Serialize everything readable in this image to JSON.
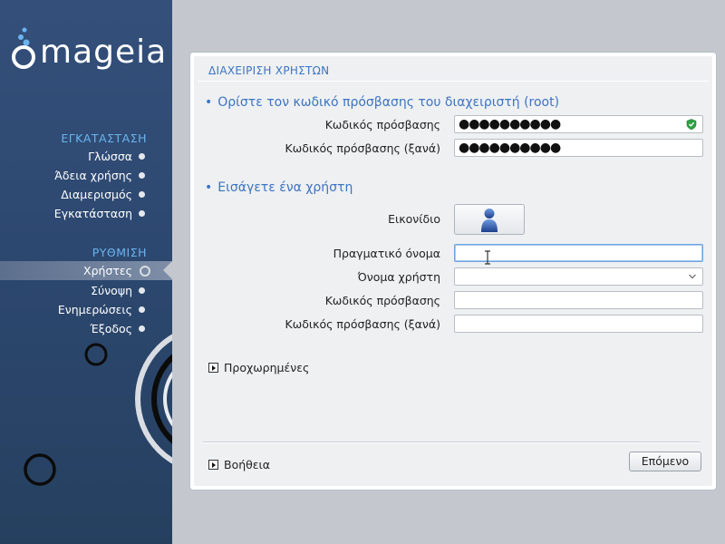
{
  "brand": {
    "logo_text": "mageia"
  },
  "sidebar": {
    "install_section": "ΕΓΚΑΤΑΣΤΑΣΗ",
    "install_items": [
      {
        "label": "Γλώσσα"
      },
      {
        "label": "Άδεια χρήσης"
      },
      {
        "label": "Διαμερισμός"
      },
      {
        "label": "Εγκατάσταση"
      }
    ],
    "config_section": "ΡΥΘΜΙΣΗ",
    "config_items": [
      {
        "label": "Χρήστες",
        "active": true
      },
      {
        "label": "Σύνοψη"
      },
      {
        "label": "Ενημερώσεις"
      },
      {
        "label": "Έξοδος"
      }
    ]
  },
  "panel": {
    "title": "ΔΙΑΧΕΙΡΙΣΗ ΧΡΗΣΤΩΝ",
    "root_section": {
      "bullet": "•",
      "heading": "Ορίστε τον κωδικό πρόσβασης του διαχειριστή (root)",
      "password_label": "Κωδικός πρόσβασης",
      "password_value": "●●●●●●●●●●",
      "password_again_label": "Κωδικός πρόσβασης (ξανά)",
      "password_again_value": "●●●●●●●●●●"
    },
    "user_section": {
      "bullet": "•",
      "heading": "Εισάγετε ένα χρήστη",
      "icon_label": "Εικονίδιο",
      "real_name_label": "Πραγματικό όνομα",
      "real_name_value": "",
      "username_label": "Όνομα χρήστη",
      "username_value": "",
      "password_label": "Κωδικός πρόσβασης",
      "password_value": "",
      "password_again_label": "Κωδικός πρόσβασης (ξανά)",
      "password_again_value": ""
    },
    "advanced_label": "Προχωρημένες",
    "help_label": "Βοήθεια",
    "next_label": "Επόμενο"
  },
  "colors": {
    "accent": "#3d74c2",
    "sidebar_bg": "#2d4870",
    "section_title": "#6ab4f0",
    "password_strength": "#2ea043"
  }
}
